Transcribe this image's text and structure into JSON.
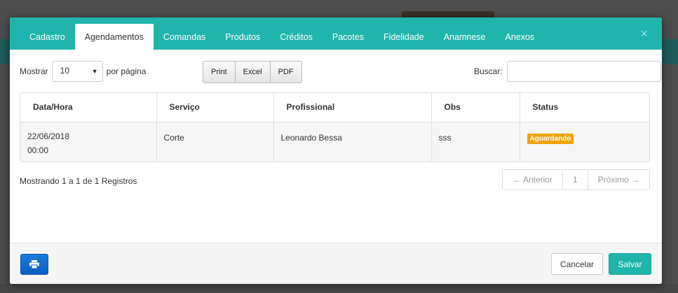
{
  "tabs": [
    {
      "label": "Cadastro"
    },
    {
      "label": "Agendamentos"
    },
    {
      "label": "Comandas"
    },
    {
      "label": "Produtos"
    },
    {
      "label": "Créditos"
    },
    {
      "label": "Pacotes"
    },
    {
      "label": "Fidelidade"
    },
    {
      "label": "Anamnese"
    },
    {
      "label": "Anexos"
    }
  ],
  "active_tab": "Agendamentos",
  "close_glyph": "×",
  "length_control": {
    "prefix": "Mostrar",
    "value": "10",
    "suffix": "por página"
  },
  "export_buttons": {
    "print": "Print",
    "excel": "Excel",
    "pdf": "PDF"
  },
  "search": {
    "label": "Buscar:",
    "value": ""
  },
  "table": {
    "headers": [
      "Data/Hora",
      "Serviço",
      "Profissional",
      "Obs",
      "Status"
    ],
    "rows": [
      {
        "date": "22/06/2018",
        "time": "00:00",
        "servico": "Corte",
        "profissional": "Leonardo Bessa",
        "obs": "sss",
        "status": "Aguardando"
      }
    ]
  },
  "info": "Mostrando 1 a 1 de 1 Registros",
  "pagination": {
    "prev": "← Anterior",
    "page": "1",
    "next": "Próximo →"
  },
  "footer": {
    "cancel": "Cancelar",
    "save": "Salvar"
  },
  "colors": {
    "accent": "#1fb5ac",
    "badge": "#f0a30a",
    "print_button": "#0a5fc0"
  }
}
